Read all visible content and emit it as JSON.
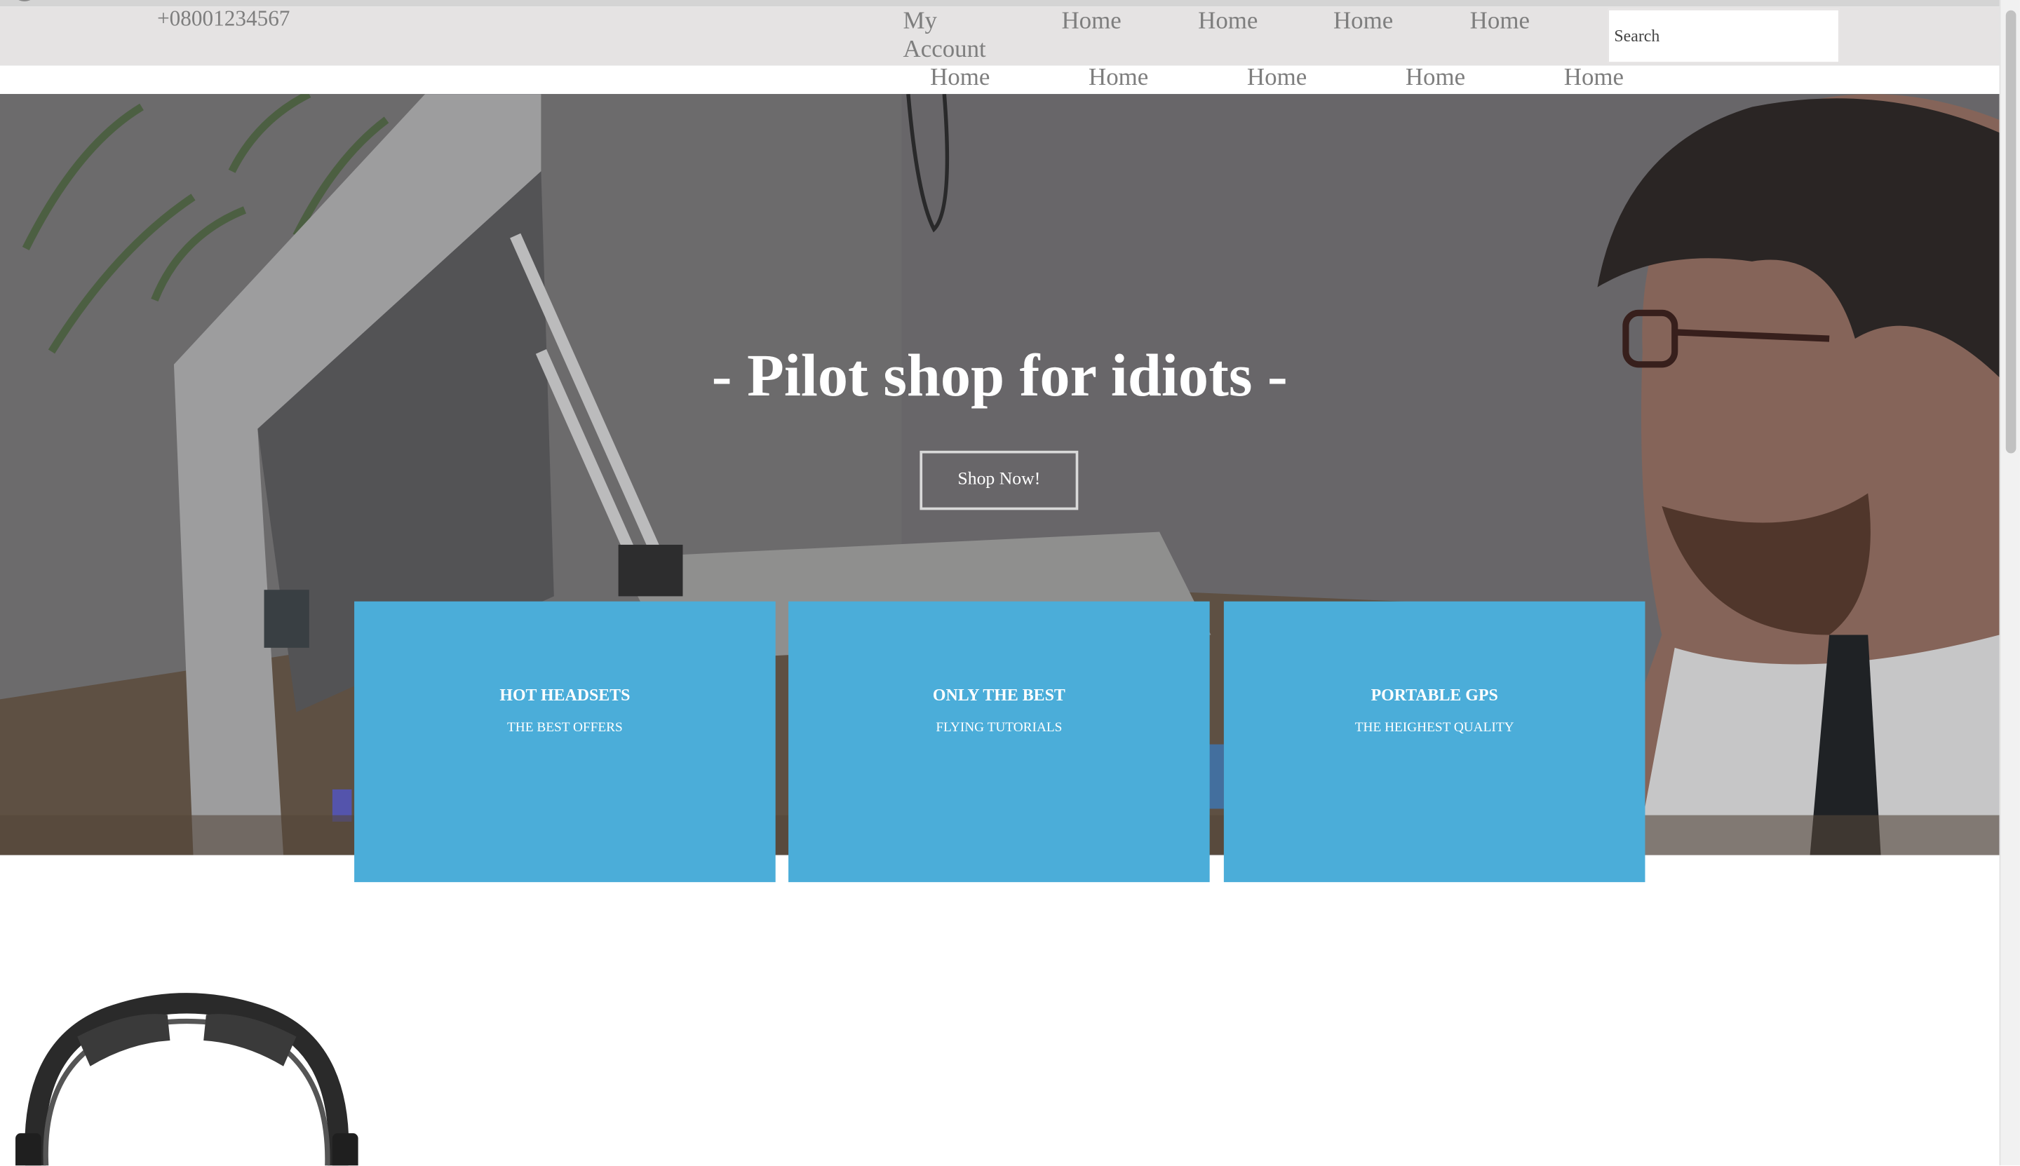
{
  "header": {
    "phone": "+08001234567",
    "nav_primary": [
      "My Account",
      "Home",
      "Home",
      "Home",
      "Home"
    ],
    "search_placeholder": "Search"
  },
  "nav_secondary": [
    "Home",
    "Home",
    "Home",
    "Home",
    "Home"
  ],
  "hero": {
    "title": "- Pilot shop for idiots -",
    "cta_label": "Shop Now!"
  },
  "cards": [
    {
      "title": "HOT HEADSETS",
      "subtitle": "THE BEST OFFERS"
    },
    {
      "title": "ONLY THE BEST",
      "subtitle": "FLYING TUTORIALS"
    },
    {
      "title": "PORTABLE GPS",
      "subtitle": "THE HEIGHEST QUALITY"
    }
  ],
  "colors": {
    "card_blue": "#4badd9",
    "header_bg": "#e5e3e3",
    "nav_text": "#7e7e7e"
  },
  "icons": [
    "headset-product-image"
  ]
}
